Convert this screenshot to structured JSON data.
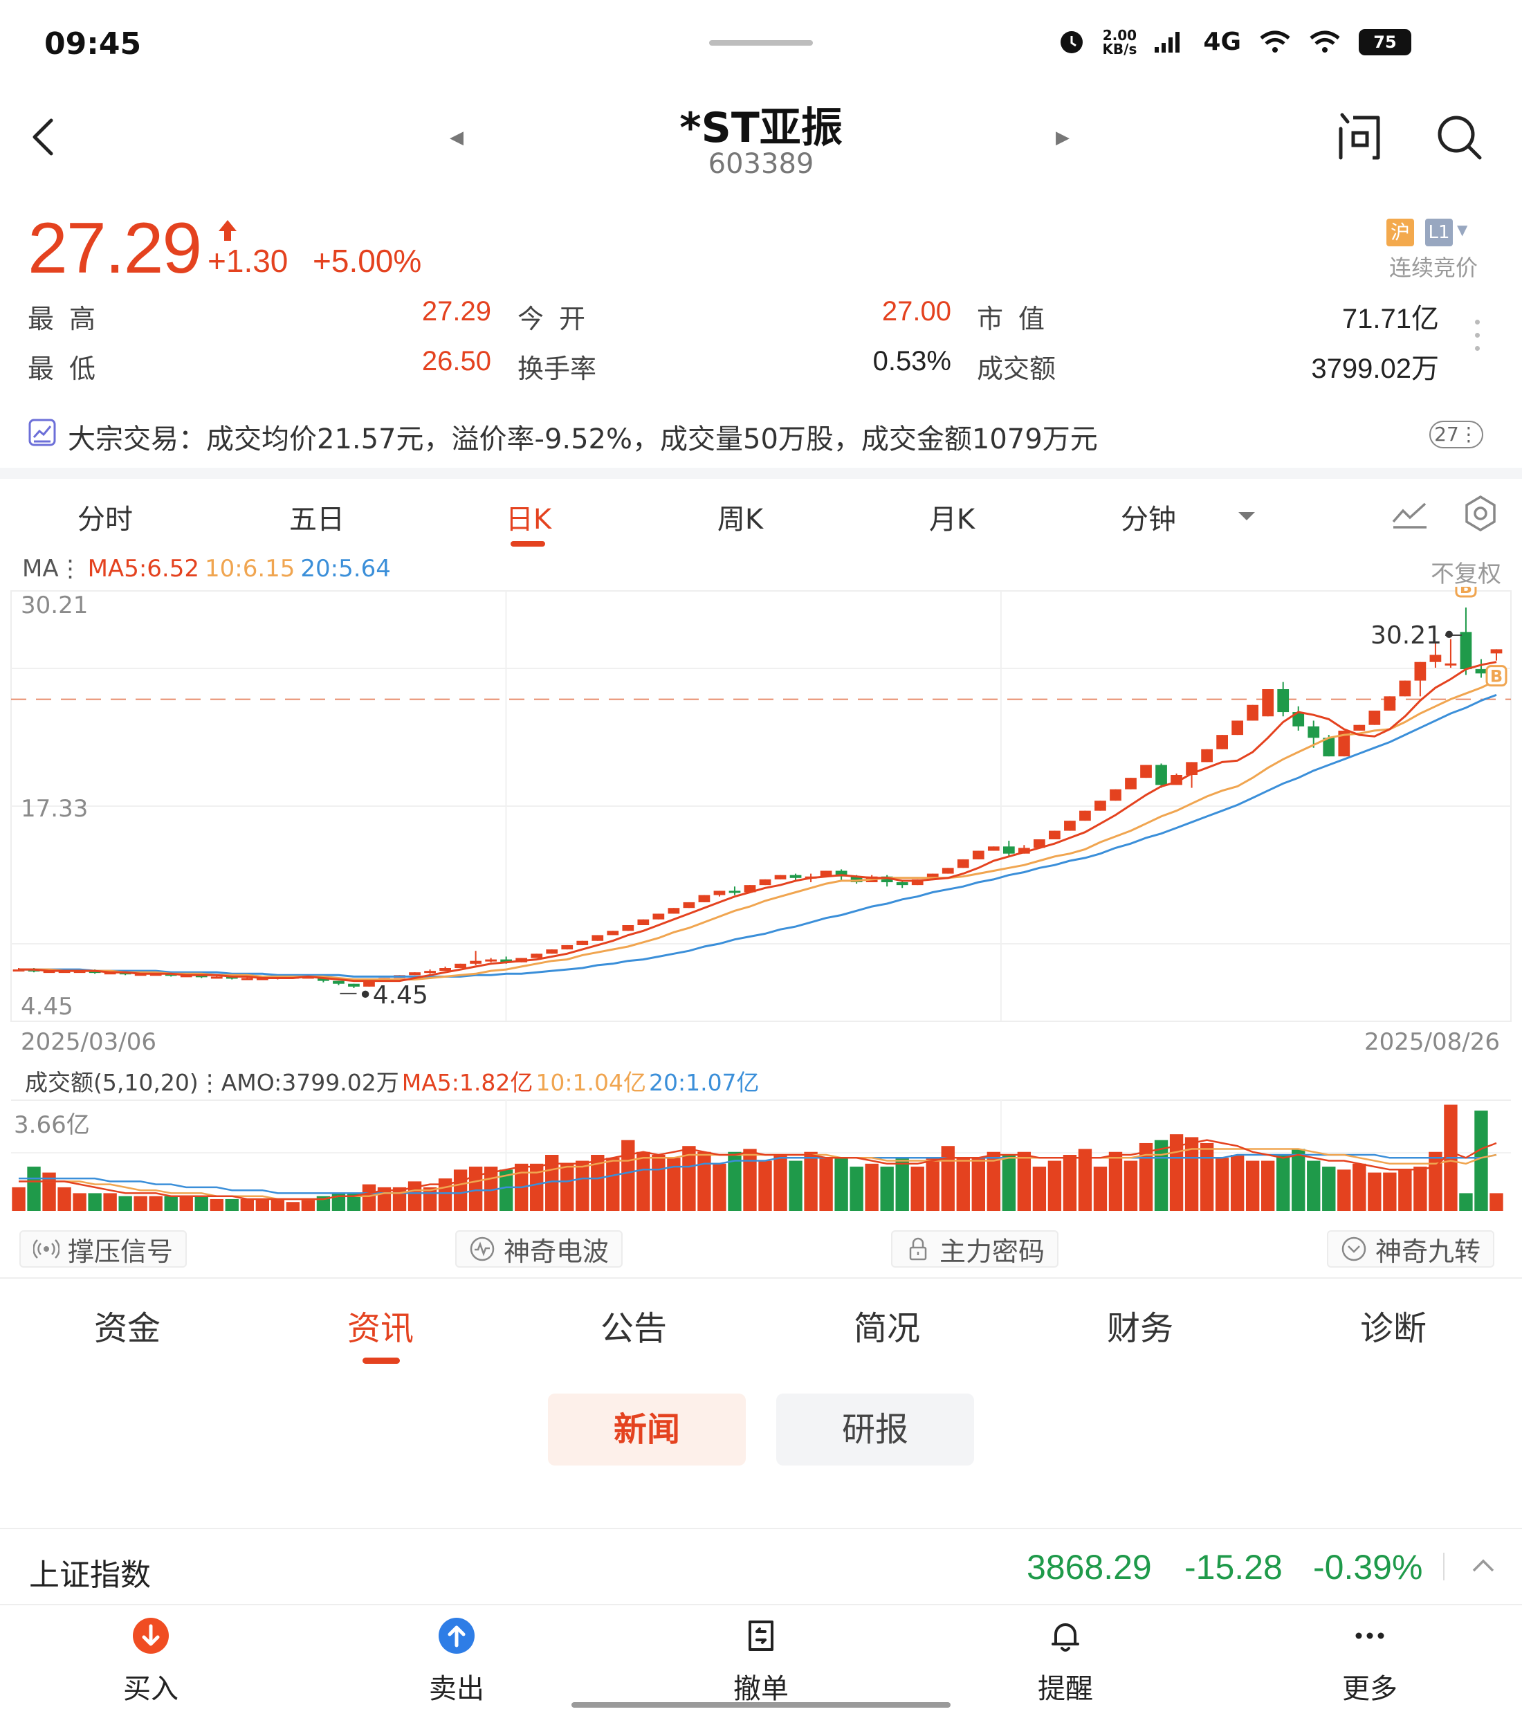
{
  "status_bar": {
    "time": "09:45",
    "speed_value": "2.00",
    "speed_unit": "KB/s",
    "network": "4G",
    "battery": "75"
  },
  "header": {
    "stock_name": "*ST亚振",
    "stock_code": "603389"
  },
  "quote": {
    "price": "27.29",
    "change": "+1.30",
    "change_pct": "+5.00%",
    "market_tag": "沪",
    "level_tag": "L1",
    "trading_status": "连续竞价",
    "rows": [
      {
        "l1": "最高",
        "v1": "27.29",
        "l2": "今开",
        "v2": "27.00",
        "l3": "市值",
        "v3": "71.71亿"
      },
      {
        "l1": "最低",
        "v1": "26.50",
        "l2": "换手率",
        "v2": "0.53%",
        "l3": "成交额",
        "v3": "3799.02万"
      }
    ]
  },
  "block_trade": {
    "text": "大宗交易：成交均价21.57元，溢价率-9.52%，成交量50万股，成交金额1079万元",
    "badge": "27"
  },
  "chart_tabs": [
    "分时",
    "五日",
    "日K",
    "周K",
    "月K",
    "分钟"
  ],
  "chart_tabs_active": "日K",
  "ma_legend": {
    "prefix": "MA⋮",
    "ma5": "MA5:6.52",
    "ma10": "10:6.15",
    "ma20": "20:5.64",
    "adjust": "不复权"
  },
  "colors": {
    "up": "#e4421f",
    "down": "#1f9a4a",
    "ma5": "#e4421f",
    "ma10": "#f0a550",
    "ma20": "#3b8fd9",
    "accent": "#e4421f"
  },
  "chart_data": {
    "type": "candlestick",
    "y_axis_labels": [
      "30.21",
      "17.33",
      "4.45"
    ],
    "ylim": [
      4.45,
      30.21
    ],
    "max_label": "30.21",
    "min_label": "4.45",
    "last_close": 27.29,
    "x_start": "2025/03/06",
    "x_end": "2025/08/26",
    "candles": [
      [
        4.9,
        4.9,
        4.8,
        5.0
      ],
      [
        4.9,
        4.8,
        4.7,
        5.0
      ],
      [
        4.8,
        4.8,
        4.7,
        4.9
      ],
      [
        4.8,
        4.8,
        4.7,
        4.9
      ],
      [
        4.8,
        4.8,
        4.7,
        4.9
      ],
      [
        4.8,
        4.7,
        4.6,
        4.9
      ],
      [
        4.7,
        4.7,
        4.6,
        4.8
      ],
      [
        4.7,
        4.6,
        4.5,
        4.8
      ],
      [
        4.6,
        4.6,
        4.5,
        4.7
      ],
      [
        4.6,
        4.6,
        4.5,
        4.7
      ],
      [
        4.6,
        4.5,
        4.4,
        4.6
      ],
      [
        4.5,
        4.5,
        4.4,
        4.6
      ],
      [
        4.5,
        4.4,
        4.3,
        4.6
      ],
      [
        4.4,
        4.4,
        4.3,
        4.5
      ],
      [
        4.4,
        4.3,
        4.2,
        4.5
      ],
      [
        4.3,
        4.3,
        4.2,
        4.4
      ],
      [
        4.3,
        4.3,
        4.2,
        4.4
      ],
      [
        4.3,
        4.4,
        4.2,
        4.4
      ],
      [
        4.4,
        4.4,
        4.3,
        4.5
      ],
      [
        4.4,
        4.4,
        4.3,
        4.5
      ],
      [
        4.4,
        4.1,
        4.0,
        4.4
      ],
      [
        4.1,
        3.9,
        3.8,
        4.1
      ],
      [
        3.9,
        3.7,
        3.6,
        3.9
      ],
      [
        3.7,
        4.1,
        3.7,
        4.1
      ],
      [
        4.1,
        4.3,
        4.1,
        4.3
      ],
      [
        4.3,
        4.5,
        4.3,
        4.5
      ],
      [
        4.5,
        4.7,
        4.5,
        4.7
      ],
      [
        4.7,
        4.8,
        4.6,
        4.9
      ],
      [
        4.8,
        5.0,
        4.8,
        5.1
      ],
      [
        5.0,
        5.3,
        5.0,
        5.3
      ],
      [
        5.3,
        5.5,
        5.2,
        6.2
      ],
      [
        5.5,
        5.6,
        5.4,
        5.7
      ],
      [
        5.6,
        5.4,
        5.3,
        5.8
      ],
      [
        5.4,
        5.7,
        5.4,
        5.7
      ],
      [
        5.7,
        6.0,
        5.7,
        6.0
      ],
      [
        6.0,
        6.3,
        6.0,
        6.3
      ],
      [
        6.3,
        6.6,
        6.3,
        6.6
      ],
      [
        6.6,
        6.9,
        6.6,
        6.9
      ],
      [
        6.9,
        7.3,
        6.9,
        7.3
      ],
      [
        7.3,
        7.6,
        7.3,
        7.6
      ],
      [
        7.6,
        8.0,
        7.6,
        8.0
      ],
      [
        8.0,
        8.4,
        8.0,
        8.4
      ],
      [
        8.4,
        8.8,
        8.4,
        8.8
      ],
      [
        8.8,
        9.2,
        8.8,
        9.2
      ],
      [
        9.2,
        9.6,
        9.2,
        9.6
      ],
      [
        9.6,
        10.1,
        9.6,
        10.1
      ],
      [
        10.1,
        10.4,
        10.0,
        10.4
      ],
      [
        10.4,
        10.3,
        10.1,
        10.7
      ],
      [
        10.3,
        10.8,
        10.3,
        10.8
      ],
      [
        10.8,
        11.2,
        10.8,
        11.2
      ],
      [
        11.2,
        11.5,
        11.2,
        11.5
      ],
      [
        11.5,
        11.3,
        11.1,
        11.6
      ],
      [
        11.3,
        11.4,
        11.0,
        11.6
      ],
      [
        11.4,
        11.8,
        11.4,
        11.8
      ],
      [
        11.8,
        11.4,
        11.1,
        11.9
      ],
      [
        11.4,
        11.0,
        10.9,
        11.5
      ],
      [
        11.0,
        11.4,
        11.0,
        11.5
      ],
      [
        11.4,
        11.0,
        10.7,
        11.5
      ],
      [
        11.0,
        10.8,
        10.6,
        11.1
      ],
      [
        10.8,
        11.2,
        10.8,
        11.2
      ],
      [
        11.2,
        11.6,
        11.2,
        11.6
      ],
      [
        11.6,
        12.0,
        11.6,
        12.0
      ],
      [
        12.0,
        12.6,
        12.0,
        12.6
      ],
      [
        12.6,
        13.2,
        12.6,
        13.2
      ],
      [
        13.2,
        13.5,
        13.2,
        13.5
      ],
      [
        13.5,
        13.0,
        12.8,
        13.9
      ],
      [
        13.0,
        13.4,
        13.0,
        13.6
      ],
      [
        13.4,
        14.0,
        13.4,
        14.0
      ],
      [
        14.0,
        14.6,
        14.0,
        14.6
      ],
      [
        14.6,
        15.3,
        14.6,
        15.3
      ],
      [
        15.3,
        16.0,
        15.3,
        16.0
      ],
      [
        16.0,
        16.7,
        16.0,
        16.7
      ],
      [
        16.7,
        17.5,
        16.7,
        17.5
      ],
      [
        17.5,
        18.3,
        17.5,
        18.3
      ],
      [
        18.3,
        19.2,
        18.3,
        19.2
      ],
      [
        19.2,
        17.8,
        17.6,
        19.3
      ],
      [
        17.8,
        18.5,
        17.8,
        18.6
      ],
      [
        18.5,
        19.4,
        17.6,
        19.4
      ],
      [
        19.4,
        20.3,
        19.4,
        20.3
      ],
      [
        20.3,
        21.3,
        20.3,
        21.3
      ],
      [
        21.3,
        22.3,
        21.3,
        22.3
      ],
      [
        22.3,
        23.4,
        22.3,
        23.4
      ],
      [
        22.6,
        24.5,
        22.6,
        24.5
      ],
      [
        24.5,
        22.9,
        22.6,
        25.0
      ],
      [
        22.9,
        21.9,
        21.6,
        23.3
      ],
      [
        21.9,
        21.1,
        20.4,
        22.3
      ],
      [
        21.1,
        19.8,
        19.8,
        21.3
      ],
      [
        19.8,
        21.6,
        19.8,
        21.6
      ],
      [
        21.6,
        22.0,
        21.6,
        22.0
      ],
      [
        22.0,
        23.0,
        22.0,
        23.0
      ],
      [
        23.0,
        24.0,
        23.0,
        24.0
      ],
      [
        24.0,
        25.1,
        24.0,
        25.1
      ],
      [
        25.1,
        26.4,
        24.0,
        26.4
      ],
      [
        26.4,
        26.9,
        26.0,
        27.7
      ],
      [
        26.3,
        26.3,
        26.0,
        28.0
      ],
      [
        28.5,
        25.9,
        25.5,
        30.21
      ],
      [
        25.9,
        25.6,
        25.3,
        26.6
      ],
      [
        27.0,
        27.29,
        26.5,
        27.29
      ]
    ],
    "ma5": [
      4.9,
      4.9,
      4.8,
      4.8,
      4.8,
      4.8,
      4.7,
      4.7,
      4.6,
      4.6,
      4.6,
      4.5,
      4.5,
      4.5,
      4.4,
      4.4,
      4.3,
      4.3,
      4.3,
      4.4,
      4.3,
      4.2,
      4.1,
      4.1,
      4.1,
      4.1,
      4.3,
      4.5,
      4.7,
      4.9,
      5.1,
      5.3,
      5.4,
      5.5,
      5.6,
      5.8,
      6.0,
      6.3,
      6.6,
      6.9,
      7.3,
      7.6,
      8.0,
      8.4,
      8.8,
      9.2,
      9.6,
      10.0,
      10.3,
      10.6,
      10.8,
      11.1,
      11.3,
      11.4,
      11.5,
      11.4,
      11.3,
      11.3,
      11.1,
      11.1,
      11.2,
      11.3,
      11.6,
      12.0,
      12.5,
      12.8,
      13.1,
      13.4,
      13.7,
      14.1,
      14.5,
      15.1,
      15.7,
      16.4,
      17.1,
      17.7,
      18.0,
      18.6,
      19.0,
      19.4,
      19.5,
      20.1,
      21.1,
      22.2,
      22.9,
      22.7,
      22.4,
      21.7,
      21.3,
      21.2,
      21.7,
      22.6,
      23.7,
      24.6,
      25.2,
      25.9,
      26.2,
      26.4
    ],
    "ma10": [
      4.9,
      4.9,
      4.9,
      4.8,
      4.8,
      4.8,
      4.8,
      4.7,
      4.7,
      4.7,
      4.6,
      4.6,
      4.6,
      4.5,
      4.5,
      4.5,
      4.4,
      4.4,
      4.4,
      4.4,
      4.4,
      4.3,
      4.2,
      4.2,
      4.2,
      4.2,
      4.2,
      4.3,
      4.4,
      4.5,
      4.6,
      4.8,
      4.9,
      5.1,
      5.3,
      5.5,
      5.6,
      5.9,
      6.1,
      6.3,
      6.5,
      6.8,
      7.1,
      7.5,
      7.8,
      8.2,
      8.6,
      9.0,
      9.3,
      9.7,
      10.0,
      10.3,
      10.6,
      10.9,
      11.1,
      11.1,
      11.2,
      11.3,
      11.3,
      11.3,
      11.3,
      11.3,
      11.4,
      11.6,
      11.8,
      12.0,
      12.2,
      12.5,
      12.8,
      13.0,
      13.3,
      13.8,
      14.2,
      14.6,
      15.1,
      15.6,
      16.0,
      16.5,
      17.0,
      17.4,
      17.7,
      18.3,
      19.0,
      19.6,
      20.1,
      20.6,
      21.1,
      21.3,
      21.4,
      21.6,
      21.7,
      22.2,
      22.8,
      23.3,
      23.8,
      24.2,
      24.6,
      25.1
    ],
    "ma20": [
      4.9,
      4.9,
      4.9,
      4.9,
      4.9,
      4.8,
      4.8,
      4.8,
      4.8,
      4.8,
      4.7,
      4.7,
      4.7,
      4.7,
      4.6,
      4.6,
      4.6,
      4.5,
      4.5,
      4.5,
      4.5,
      4.5,
      4.4,
      4.4,
      4.4,
      4.4,
      4.4,
      4.4,
      4.4,
      4.4,
      4.5,
      4.5,
      4.6,
      4.6,
      4.7,
      4.8,
      4.9,
      5.0,
      5.2,
      5.3,
      5.5,
      5.6,
      5.8,
      6.0,
      6.2,
      6.5,
      6.7,
      7.0,
      7.2,
      7.4,
      7.7,
      7.9,
      8.2,
      8.5,
      8.7,
      9.0,
      9.3,
      9.5,
      9.8,
      10.0,
      10.3,
      10.5,
      10.7,
      11.0,
      11.2,
      11.5,
      11.7,
      12.0,
      12.2,
      12.5,
      12.7,
      13.0,
      13.4,
      13.7,
      14.1,
      14.4,
      14.8,
      15.2,
      15.6,
      16.0,
      16.4,
      16.9,
      17.4,
      17.9,
      18.3,
      18.8,
      19.2,
      19.6,
      20.0,
      20.4,
      20.8,
      21.3,
      21.8,
      22.3,
      22.8,
      23.2,
      23.7,
      24.1
    ],
    "volume_max_label": "3.66亿",
    "volume": [
      0.8,
      1.5,
      1.3,
      0.8,
      0.6,
      0.6,
      0.6,
      0.5,
      0.5,
      0.5,
      0.5,
      0.5,
      0.5,
      0.4,
      0.4,
      0.4,
      0.4,
      0.4,
      0.3,
      0.4,
      0.5,
      0.6,
      0.6,
      0.9,
      0.8,
      0.8,
      1.0,
      0.8,
      1.1,
      1.4,
      1.5,
      1.5,
      1.4,
      1.6,
      1.6,
      1.9,
      1.6,
      1.7,
      1.9,
      1.8,
      2.4,
      2.0,
      1.9,
      1.8,
      2.2,
      2.0,
      1.6,
      2.0,
      2.1,
      1.7,
      1.9,
      1.7,
      2.0,
      1.8,
      1.8,
      1.5,
      1.6,
      1.5,
      1.8,
      1.5,
      1.8,
      2.2,
      1.8,
      1.8,
      2.0,
      1.9,
      2.0,
      1.5,
      1.7,
      1.9,
      2.1,
      1.5,
      2.0,
      1.7,
      2.3,
      2.4,
      2.6,
      2.5,
      2.3,
      1.8,
      1.9,
      1.7,
      1.7,
      1.9,
      2.1,
      1.7,
      1.5,
      1.4,
      1.6,
      1.3,
      1.3,
      1.4,
      1.5,
      2.0,
      3.6,
      0.6,
      3.4,
      0.6
    ],
    "vol_ma5": [
      1.0,
      1.0,
      1.0,
      1.0,
      0.9,
      0.8,
      0.7,
      0.6,
      0.6,
      0.6,
      0.5,
      0.5,
      0.5,
      0.5,
      0.5,
      0.4,
      0.4,
      0.4,
      0.4,
      0.4,
      0.4,
      0.5,
      0.5,
      0.6,
      0.7,
      0.7,
      0.8,
      0.9,
      0.9,
      1.0,
      1.2,
      1.3,
      1.4,
      1.5,
      1.5,
      1.6,
      1.6,
      1.6,
      1.7,
      1.8,
      1.9,
      2.0,
      1.9,
      2.0,
      2.1,
      2.0,
      1.9,
      1.9,
      2.0,
      1.9,
      1.9,
      1.9,
      1.9,
      1.8,
      1.8,
      1.8,
      1.7,
      1.6,
      1.6,
      1.6,
      1.7,
      1.8,
      1.8,
      1.8,
      1.9,
      1.9,
      1.9,
      1.8,
      1.8,
      1.8,
      1.8,
      1.8,
      1.9,
      1.9,
      2.0,
      2.1,
      2.2,
      2.3,
      2.4,
      2.3,
      2.2,
      2.0,
      1.9,
      1.8,
      1.9,
      1.8,
      1.7,
      1.7,
      1.6,
      1.5,
      1.4,
      1.4,
      1.4,
      1.5,
      2.0,
      1.8,
      2.1,
      2.3
    ],
    "vol_ma10": [
      1.0,
      1.0,
      1.0,
      1.0,
      1.0,
      0.9,
      0.9,
      0.8,
      0.7,
      0.7,
      0.6,
      0.6,
      0.6,
      0.5,
      0.5,
      0.5,
      0.5,
      0.4,
      0.4,
      0.4,
      0.4,
      0.5,
      0.5,
      0.5,
      0.6,
      0.6,
      0.7,
      0.7,
      0.8,
      0.9,
      1.0,
      1.1,
      1.2,
      1.3,
      1.3,
      1.4,
      1.5,
      1.5,
      1.6,
      1.7,
      1.7,
      1.8,
      1.8,
      1.8,
      1.9,
      1.9,
      1.9,
      1.9,
      1.9,
      1.9,
      1.9,
      1.9,
      1.9,
      1.9,
      1.8,
      1.8,
      1.8,
      1.7,
      1.7,
      1.7,
      1.7,
      1.7,
      1.7,
      1.7,
      1.7,
      1.8,
      1.8,
      1.8,
      1.8,
      1.8,
      1.8,
      1.8,
      1.8,
      1.8,
      1.9,
      1.9,
      2.0,
      2.1,
      2.1,
      2.1,
      2.1,
      2.1,
      2.1,
      2.1,
      2.1,
      2.0,
      1.9,
      1.9,
      1.8,
      1.7,
      1.6,
      1.6,
      1.6,
      1.6,
      1.7,
      1.6,
      1.8,
      1.9
    ],
    "vol_ma20": [
      1.1,
      1.1,
      1.1,
      1.1,
      1.1,
      1.1,
      1.0,
      1.0,
      1.0,
      0.9,
      0.9,
      0.8,
      0.8,
      0.8,
      0.7,
      0.7,
      0.7,
      0.6,
      0.6,
      0.6,
      0.6,
      0.6,
      0.6,
      0.6,
      0.6,
      0.6,
      0.6,
      0.6,
      0.6,
      0.6,
      0.7,
      0.7,
      0.8,
      0.8,
      0.9,
      1.0,
      1.0,
      1.1,
      1.1,
      1.2,
      1.3,
      1.4,
      1.4,
      1.5,
      1.5,
      1.6,
      1.6,
      1.7,
      1.7,
      1.7,
      1.8,
      1.8,
      1.8,
      1.8,
      1.8,
      1.8,
      1.8,
      1.8,
      1.8,
      1.8,
      1.8,
      1.8,
      1.8,
      1.8,
      1.8,
      1.8,
      1.8,
      1.8,
      1.8,
      1.8,
      1.8,
      1.8,
      1.8,
      1.8,
      1.8,
      1.8,
      1.8,
      1.8,
      1.8,
      1.8,
      1.9,
      1.9,
      1.9,
      1.9,
      1.9,
      1.9,
      1.9,
      1.9,
      1.9,
      1.9,
      1.8,
      1.8,
      1.8,
      1.8,
      1.8,
      1.8,
      1.8,
      1.9
    ],
    "markers": [
      {
        "label": "B",
        "index": 95
      },
      {
        "label": "B",
        "index": 97
      }
    ]
  },
  "volume_legend": {
    "prefix": "成交额(5,10,20)⋮AMO:3799.02万",
    "ma5": "MA5:1.82亿",
    "ma10": "10:1.04亿",
    "ma20": "20:1.07亿",
    "max_label": "3.66亿"
  },
  "signals": [
    "撑压信号",
    "神奇电波",
    "主力密码",
    "神奇九转"
  ],
  "info_tabs": [
    "资金",
    "资讯",
    "公告",
    "简况",
    "财务",
    "诊断"
  ],
  "info_tabs_active": "资讯",
  "sub_tabs": {
    "news": "新闻",
    "reports": "研报"
  },
  "index_ticker": {
    "name": "上证指数",
    "value": "3868.29",
    "change": "-15.28",
    "change_pct": "-0.39%"
  },
  "bottom_bar": [
    {
      "label": "买入",
      "icon": "buy-icon"
    },
    {
      "label": "卖出",
      "icon": "sell-icon"
    },
    {
      "label": "撤单",
      "icon": "cancel-order-icon"
    },
    {
      "label": "提醒",
      "icon": "bell-icon"
    },
    {
      "label": "更多",
      "icon": "more-icon"
    }
  ]
}
